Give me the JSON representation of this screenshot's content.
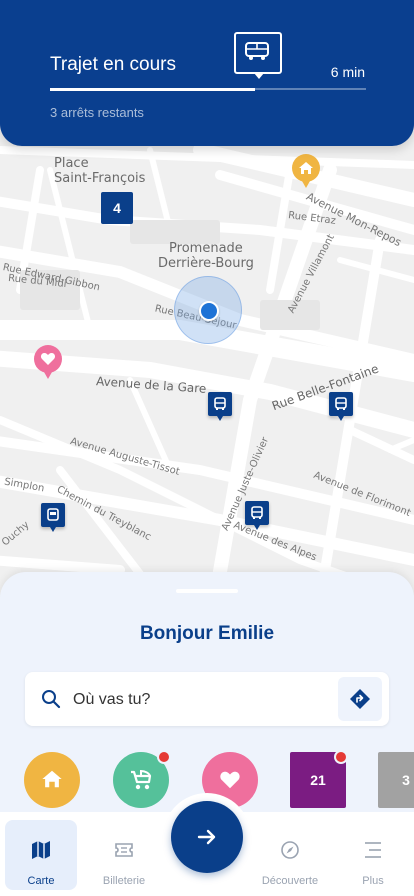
{
  "trip": {
    "title": "Trajet en cours",
    "duration": "6 min",
    "remaining": "3 arrêts restants",
    "progress_fraction": 0.65
  },
  "map": {
    "labels": {
      "place_st_francois": "Place\nSaint-François",
      "promenade": "Promenade\nDerrière-Bourg",
      "avenue_mon_repos": "Avenue Mon-Repos",
      "rue_etraz": "Rue Etraz",
      "rue_edward_gibbon": "Rue Edward-Gibbon",
      "rue_du_midi": "Rue du Midi",
      "rue_beau_sejour": "Rue Beau-Séjour",
      "avenue_villamont": "Avenue Villamont",
      "avenue_gare": "Avenue de la Gare",
      "rue_belle_fontaine": "Rue Belle-Fontaine",
      "avenue_auguste_tissot": "Avenue Auguste-Tissot",
      "avenue_juste_olivier": "Avenue Juste-Olivier",
      "simplon": "Simplon",
      "chemin_treyblanc": "Chemin du Treyblanc",
      "ouchy": "Ouchy",
      "avenue_florimont": "Avenue de Florimont",
      "avenue_alpes": "Avenue des Alpes"
    },
    "cluster_count": "4"
  },
  "sheet": {
    "greeting": "Bonjour Emilie",
    "search_placeholder": "Où vas tu?",
    "fav_number_1": "21",
    "fav_number_2": "3"
  },
  "tabs": {
    "carte": "Carte",
    "billeterie": "Billeterie",
    "decouverte": "Découverte",
    "plus": "Plus"
  },
  "colors": {
    "primary": "#0a3f8f",
    "home": "#f0b542",
    "stroller": "#55c19a",
    "heart": "#ef6f9d",
    "ticket": "#7b1c82",
    "grey": "#a2a2a2",
    "badge": "#e53935"
  }
}
